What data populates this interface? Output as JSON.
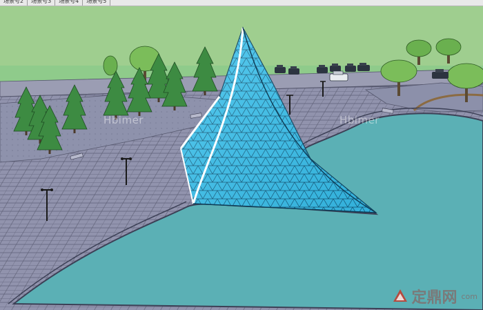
{
  "scene_tabs": [
    "场景号2",
    "场景号3",
    "场景号4",
    "场景号5"
  ],
  "watermark": "Hbimer",
  "brand": {
    "name": "定鼎网",
    "domain": "com"
  },
  "colors": {
    "sky": "#9fce8f",
    "plaza": "#9193ad",
    "water": "#5bb0b5",
    "glass": "#3fc0e8",
    "tree": "#2f8a3a"
  },
  "icons": [
    "brand-logo-icon",
    "tree-icon",
    "car-icon",
    "street-lamp-icon"
  ]
}
